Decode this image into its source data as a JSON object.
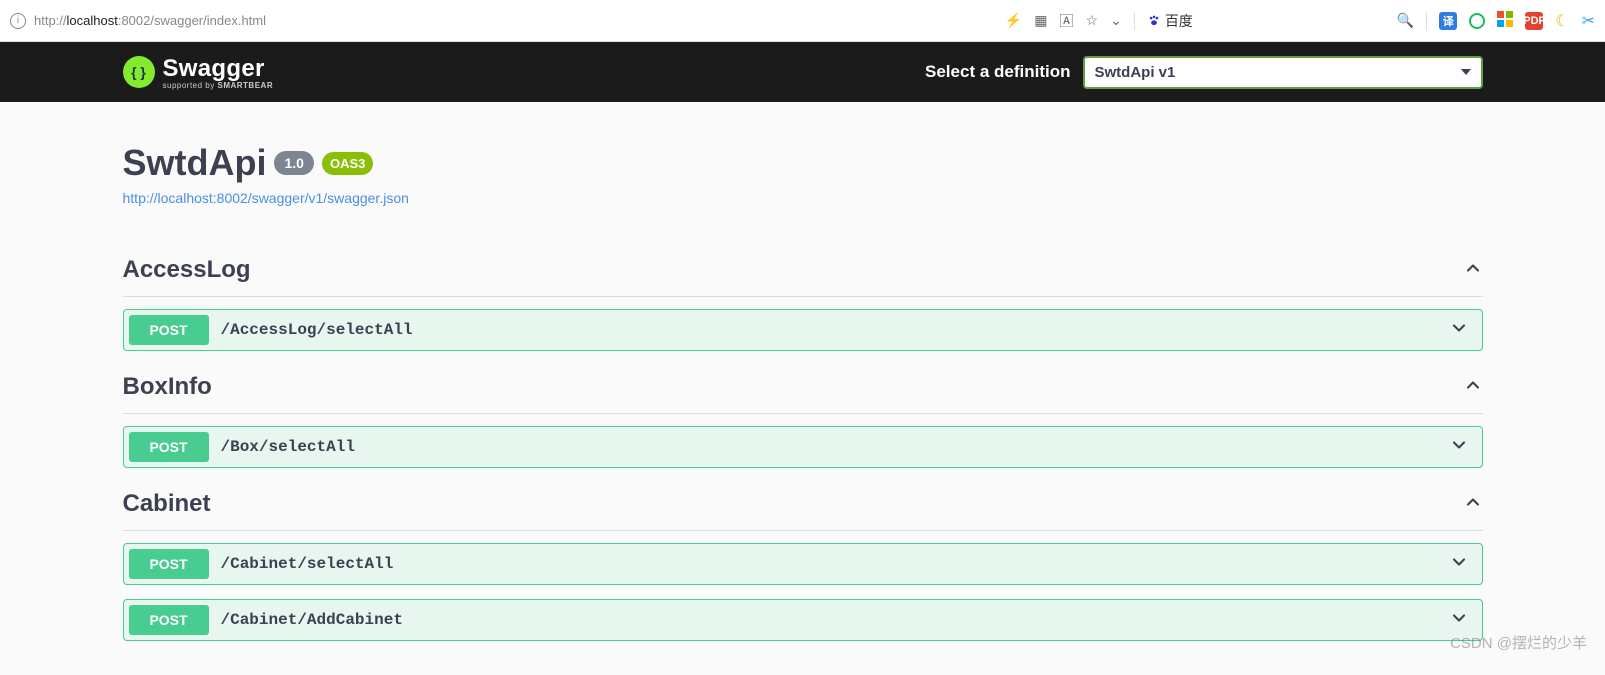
{
  "browser": {
    "url_host": "localhost",
    "url_port": ":8002",
    "url_path": "/swagger/index.html",
    "url_scheme": "http://",
    "baidu_label": "百度"
  },
  "topbar": {
    "brand": "Swagger",
    "supported_prefix": "supported by ",
    "supported_brand": "SMARTBEAR",
    "definition_label": "Select a definition",
    "definition_selected": "SwtdApi v1"
  },
  "info": {
    "title": "SwtdApi",
    "version": "1.0",
    "oas": "OAS3",
    "spec_url": "http://localhost:8002/swagger/v1/swagger.json"
  },
  "tags": [
    {
      "name": "AccessLog",
      "ops": [
        {
          "method": "POST",
          "path": "/AccessLog/selectAll"
        }
      ]
    },
    {
      "name": "BoxInfo",
      "ops": [
        {
          "method": "POST",
          "path": "/Box/selectAll"
        }
      ]
    },
    {
      "name": "Cabinet",
      "ops": [
        {
          "method": "POST",
          "path": "/Cabinet/selectAll"
        },
        {
          "method": "POST",
          "path": "/Cabinet/AddCabinet"
        }
      ]
    }
  ],
  "watermark": "CSDN @摆烂的少羊"
}
